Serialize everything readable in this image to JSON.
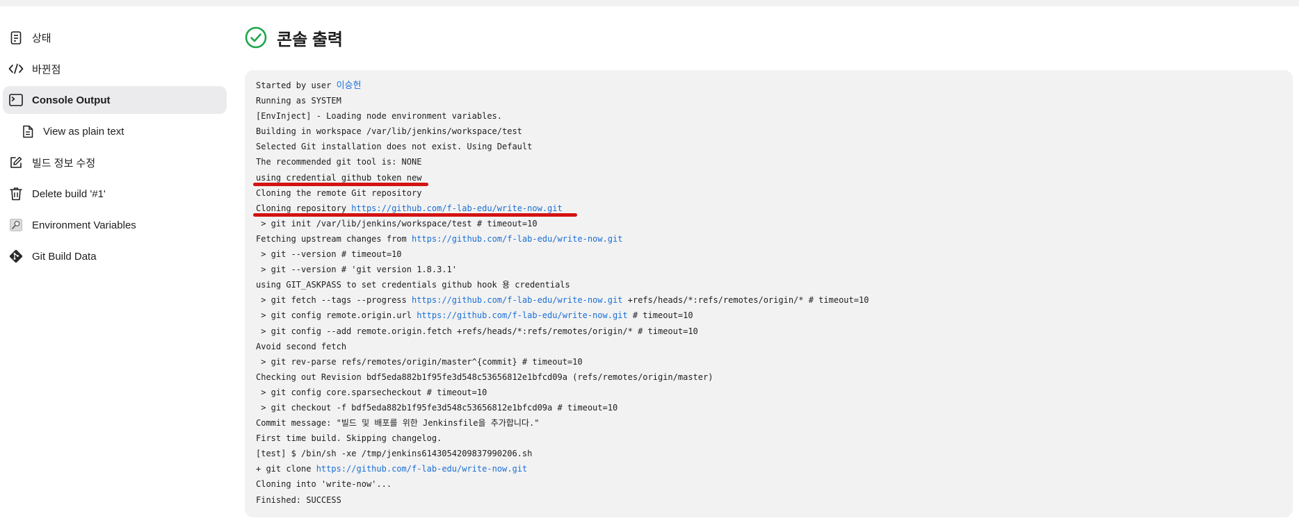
{
  "sidebar": {
    "items": [
      {
        "label": "상태",
        "icon": "document-icon"
      },
      {
        "label": "바뀐점",
        "icon": "code-icon"
      },
      {
        "label": "Console Output",
        "icon": "terminal-icon",
        "active": true
      },
      {
        "label": "View as plain text",
        "icon": "file-text-icon",
        "sub": true
      },
      {
        "label": "빌드 정보 수정",
        "icon": "edit-icon"
      },
      {
        "label": "Delete build '#1'",
        "icon": "trash-icon"
      },
      {
        "label": "Environment Variables",
        "icon": "magnifier-icon"
      },
      {
        "label": "Git Build Data",
        "icon": "git-icon"
      }
    ]
  },
  "page": {
    "title": "콘솔 출력",
    "status": "success",
    "accent_color": "#1ea64b"
  },
  "console": {
    "link_color": "#1a6fd6",
    "marker_color": "#d31212",
    "lines": [
      {
        "text": "Started by user ",
        "link": "이승헌"
      },
      {
        "text": "Running as SYSTEM"
      },
      {
        "text": "[EnvInject] - Loading node environment variables."
      },
      {
        "text": "Building in workspace /var/lib/jenkins/workspace/test"
      },
      {
        "text": "Selected Git installation does not exist. Using Default"
      },
      {
        "text": "The recommended git tool is: NONE"
      },
      {
        "text": "using credential github token new",
        "underlined": true
      },
      {
        "text": "Cloning the remote Git repository"
      },
      {
        "text": "Cloning repository ",
        "link": "https://github.com/f-lab-edu/write-now.git",
        "underlined": true
      },
      {
        "text": " > git init /var/lib/jenkins/workspace/test # timeout=10"
      },
      {
        "text": "Fetching upstream changes from ",
        "link": "https://github.com/f-lab-edu/write-now.git"
      },
      {
        "text": " > git --version # timeout=10"
      },
      {
        "text": " > git --version # 'git version 1.8.3.1'"
      },
      {
        "text": "using GIT_ASKPASS to set credentials github hook 용 credentials"
      },
      {
        "text": " > git fetch --tags --progress ",
        "link": "https://github.com/f-lab-edu/write-now.git",
        "after": " +refs/heads/*:refs/remotes/origin/* # timeout=10"
      },
      {
        "text": " > git config remote.origin.url ",
        "link": "https://github.com/f-lab-edu/write-now.git",
        "after": " # timeout=10"
      },
      {
        "text": " > git config --add remote.origin.fetch +refs/heads/*:refs/remotes/origin/* # timeout=10"
      },
      {
        "text": "Avoid second fetch"
      },
      {
        "text": " > git rev-parse refs/remotes/origin/master^{commit} # timeout=10"
      },
      {
        "text": "Checking out Revision bdf5eda882b1f95fe3d548c53656812e1bfcd09a (refs/remotes/origin/master)"
      },
      {
        "text": " > git config core.sparsecheckout # timeout=10"
      },
      {
        "text": " > git checkout -f bdf5eda882b1f95fe3d548c53656812e1bfcd09a # timeout=10"
      },
      {
        "text": "Commit message: \"빌드 및 배포를 위한 Jenkinsfile을 추가합니다.\""
      },
      {
        "text": "First time build. Skipping changelog."
      },
      {
        "text": "[test] $ /bin/sh -xe /tmp/jenkins6143054209837990206.sh"
      },
      {
        "text": "+ git clone ",
        "link": "https://github.com/f-lab-edu/write-now.git"
      },
      {
        "text": "Cloning into 'write-now'..."
      },
      {
        "text": "Finished: SUCCESS"
      }
    ]
  }
}
